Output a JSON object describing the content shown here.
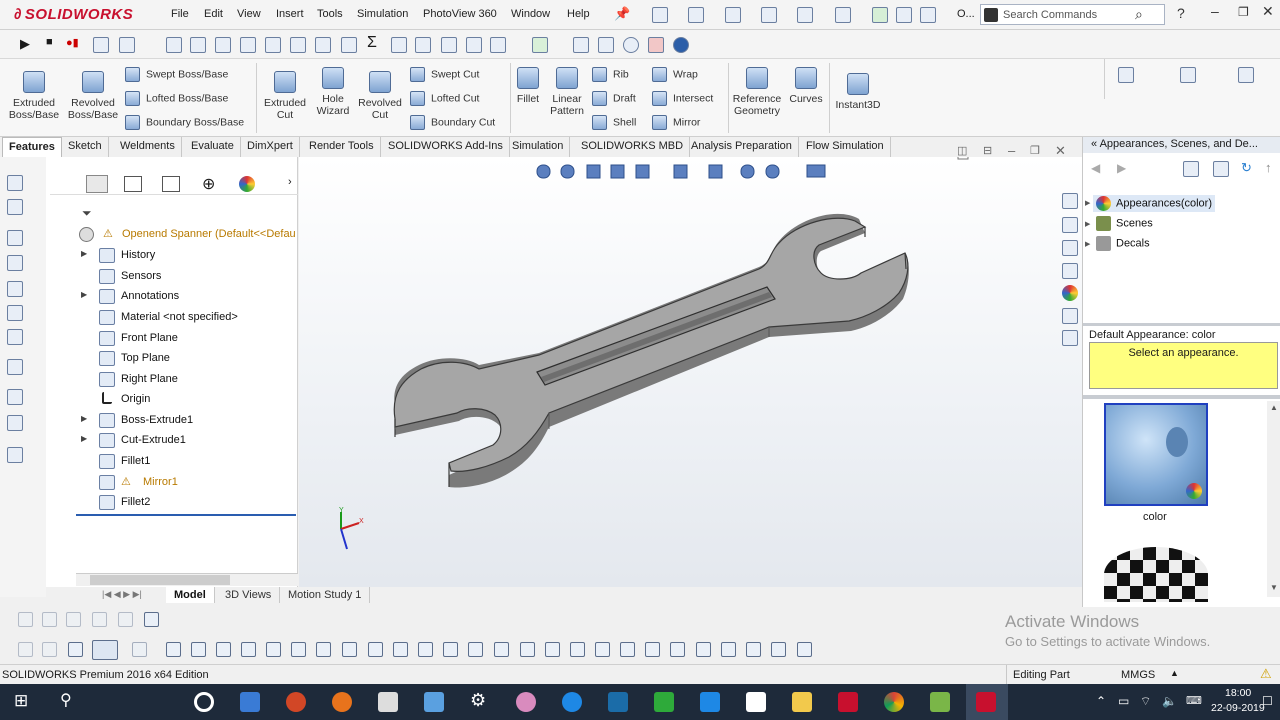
{
  "app": {
    "logo_text": "SOLIDWORKS"
  },
  "menu": {
    "items": [
      "File",
      "Edit",
      "View",
      "Insert",
      "Tools",
      "Simulation",
      "PhotoView 360",
      "Window",
      "Help"
    ],
    "overflow_label": "O..."
  },
  "search": {
    "placeholder": "Search Commands"
  },
  "command_manager": {
    "big_buttons": [
      {
        "label": "Extruded Boss/Base"
      },
      {
        "label": "Revolved Boss/Base"
      },
      {
        "label": "Extruded Cut"
      },
      {
        "label": "Hole Wizard"
      },
      {
        "label": "Revolved Cut"
      },
      {
        "label": "Fillet"
      },
      {
        "label": "Linear Pattern"
      },
      {
        "label": "Reference Geometry"
      },
      {
        "label": "Curves"
      },
      {
        "label": "Instant3D"
      }
    ],
    "small_buttons": [
      {
        "label": "Swept Boss/Base"
      },
      {
        "label": "Lofted Boss/Base"
      },
      {
        "label": "Boundary Boss/Base"
      },
      {
        "label": "Swept Cut"
      },
      {
        "label": "Lofted Cut"
      },
      {
        "label": "Boundary Cut"
      },
      {
        "label": "Rib"
      },
      {
        "label": "Draft"
      },
      {
        "label": "Shell"
      },
      {
        "label": "Wrap"
      },
      {
        "label": "Intersect"
      },
      {
        "label": "Mirror"
      }
    ]
  },
  "tabs": [
    "Features",
    "Sketch",
    "Weldments",
    "Evaluate",
    "DimXpert",
    "Render Tools",
    "SOLIDWORKS Add-Ins",
    "Simulation",
    "SOLIDWORKS MBD",
    "Analysis Preparation",
    "Flow Simulation"
  ],
  "feature_tree": {
    "root": "Openend Spanner  (Default<<Defau",
    "items": [
      {
        "label": "History",
        "expandable": true
      },
      {
        "label": "Sensors",
        "expandable": false
      },
      {
        "label": "Annotations",
        "expandable": true
      },
      {
        "label": "Material <not specified>",
        "expandable": false
      },
      {
        "label": "Front Plane",
        "expandable": false
      },
      {
        "label": "Top Plane",
        "expandable": false
      },
      {
        "label": "Right Plane",
        "expandable": false
      },
      {
        "label": "Origin",
        "expandable": false
      },
      {
        "label": "Boss-Extrude1",
        "expandable": true
      },
      {
        "label": "Cut-Extrude1",
        "expandable": true
      },
      {
        "label": "Fillet1",
        "expandable": false
      },
      {
        "label": "Mirror1",
        "expandable": false,
        "warning": true
      },
      {
        "label": "Fillet2",
        "expandable": false
      }
    ]
  },
  "bottom_tabs": [
    "Model",
    "3D Views",
    "Motion Study 1"
  ],
  "right_panel": {
    "title": "Appearances, Scenes, and De...",
    "items": [
      "Appearances(color)",
      "Scenes",
      "Decals"
    ],
    "default_appearance": "Default Appearance: color",
    "tooltip": "Select an appearance.",
    "swatch_label": "color"
  },
  "status_bar": {
    "edition": "SOLIDWORKS Premium 2016 x64 Edition",
    "mode": "Editing Part",
    "units": "MMGS"
  },
  "watermark": {
    "line1": "Activate Windows",
    "line2": "Go to Settings to activate Windows."
  },
  "taskbar": {
    "time": "18:00",
    "date": "22-09-2019",
    "colors": {
      "bg": "#1e2a3a"
    }
  },
  "colors": {
    "brand": "#c8102e",
    "tooltip_bg": "#ffff80",
    "part_gray": "#8e8e8e"
  }
}
